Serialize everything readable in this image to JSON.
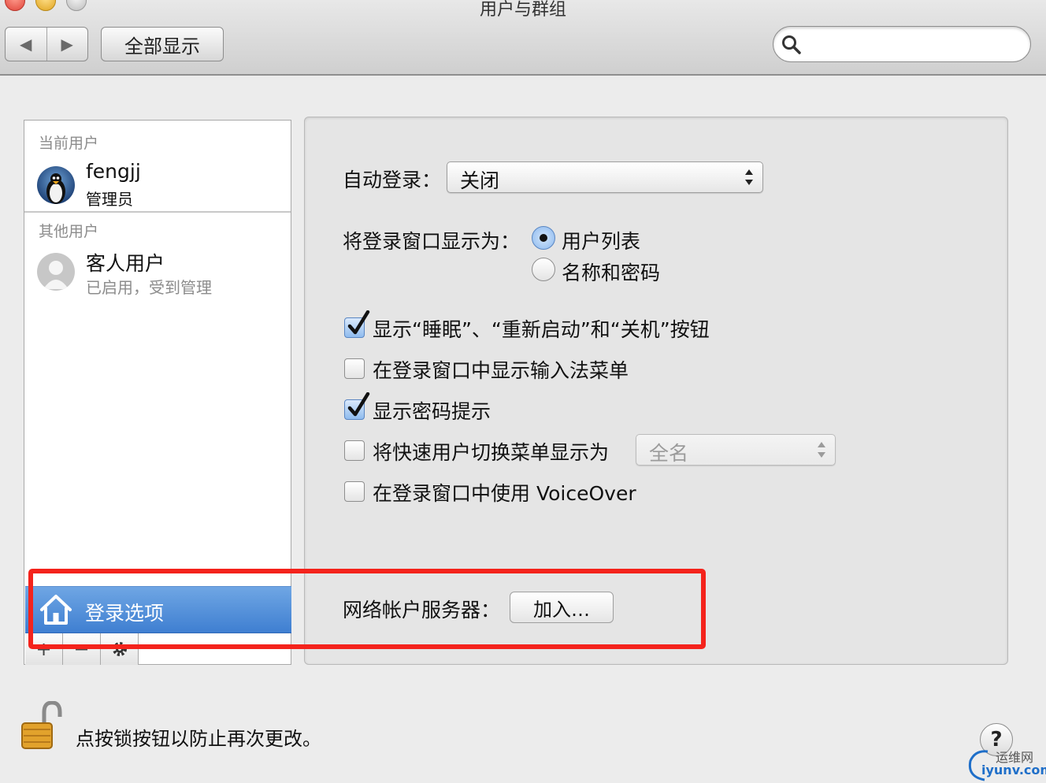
{
  "window": {
    "title": "用户与群组"
  },
  "toolbar": {
    "back_icon": "◀",
    "forward_icon": "▶",
    "show_all_label": "全部显示",
    "search_placeholder": ""
  },
  "sidebar": {
    "current_users_heading": "当前用户",
    "current_user": {
      "name": "fengjj",
      "role": "管理员",
      "avatar": "penguin-avatar"
    },
    "other_users_heading": "其他用户",
    "guest_user": {
      "name": "客人用户",
      "status": "已启用，受到管理",
      "avatar": "silhouette-avatar"
    },
    "login_options_label": "登录选项",
    "footer_buttons": [
      "+",
      "−"
    ]
  },
  "settings": {
    "auto_login_label": "自动登录：",
    "auto_login_value": "关闭",
    "display_login_as_label": "将登录窗口显示为：",
    "display_options": [
      {
        "label": "用户列表",
        "selected": true
      },
      {
        "label": "名称和密码",
        "selected": false
      }
    ],
    "checkboxes": [
      {
        "label": "显示“睡眠”、“重新启动”和“关机”按钮",
        "checked": true
      },
      {
        "label": "在登录窗口中显示输入法菜单",
        "checked": false
      },
      {
        "label": "显示密码提示",
        "checked": true
      },
      {
        "label": "将快速用户切换菜单显示为",
        "checked": false
      },
      {
        "label": "在登录窗口中使用 VoiceOver",
        "checked": false
      }
    ],
    "fast_switch_value": "全名",
    "network_server_label": "网络帐户服务器：",
    "join_button_label": "加入…"
  },
  "footer": {
    "lock_text": "点按锁按钮以防止再次更改。",
    "help_label": "?"
  },
  "watermark": {
    "cn": "运维网",
    "en": "iyunv.com"
  },
  "colors": {
    "selection_blue": "#4a88d6",
    "highlight_red": "#f4231c",
    "checkbox_blue": "#8fbbee"
  }
}
